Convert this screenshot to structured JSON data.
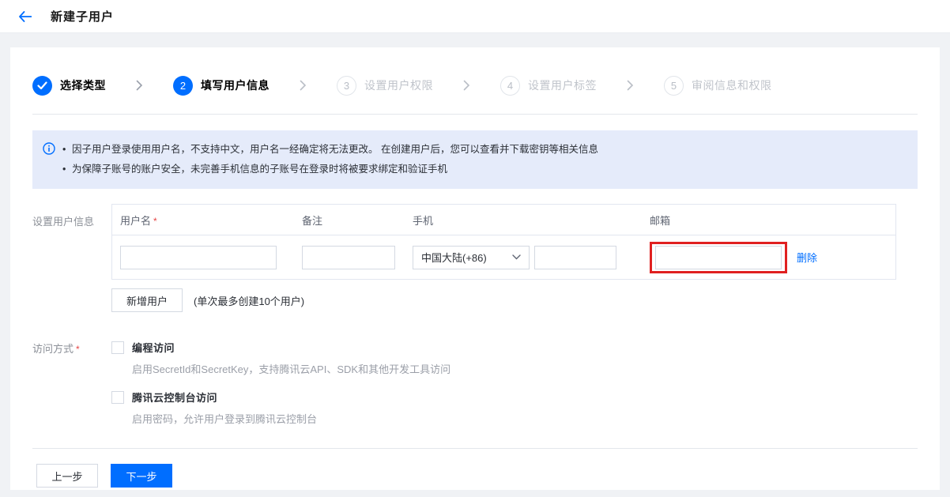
{
  "header": {
    "title": "新建子用户"
  },
  "ui": {
    "required_mark": "*"
  },
  "stepper": {
    "steps": [
      {
        "label": "选择类型",
        "indicator": "✓",
        "status": "done"
      },
      {
        "label": "填写用户信息",
        "indicator": "2",
        "status": "current"
      },
      {
        "label": "设置用户权限",
        "indicator": "3",
        "status": "pending"
      },
      {
        "label": "设置用户标签",
        "indicator": "4",
        "status": "pending"
      },
      {
        "label": "审阅信息和权限",
        "indicator": "5",
        "status": "pending"
      }
    ]
  },
  "notice": {
    "items": [
      "因子用户登录使用用户名，不支持中文，用户名一经确定将无法更改。 在创建用户后，您可以查看并下载密钥等相关信息",
      "为保障子账号的账户安全，未完善手机信息的子账号在登录时将被要求绑定和验证手机"
    ]
  },
  "user_info": {
    "section_label": "设置用户信息",
    "columns": {
      "username": "用户名",
      "remark": "备注",
      "phone": "手机",
      "email": "邮箱"
    },
    "row": {
      "username_value": "",
      "remark_value": "",
      "phone_country": "中国大陆(+86)",
      "phone_value": "",
      "email_value": "",
      "delete_label": "删除"
    },
    "add_user_button": "新增用户",
    "add_user_hint": "(单次最多创建10个用户)"
  },
  "access": {
    "section_label": "访问方式",
    "options": [
      {
        "label": "编程访问",
        "desc": "启用SecretId和SecretKey，支持腾讯云API、SDK和其他开发工具访问",
        "checked": false
      },
      {
        "label": "腾讯云控制台访问",
        "desc": "启用密码，允许用户登录到腾讯云控制台",
        "checked": false
      }
    ]
  },
  "footer": {
    "prev_label": "上一步",
    "next_label": "下一步"
  },
  "colors": {
    "primary": "#006eff",
    "annotation_red": "#e02020",
    "banner_bg": "#e5ebfa"
  }
}
